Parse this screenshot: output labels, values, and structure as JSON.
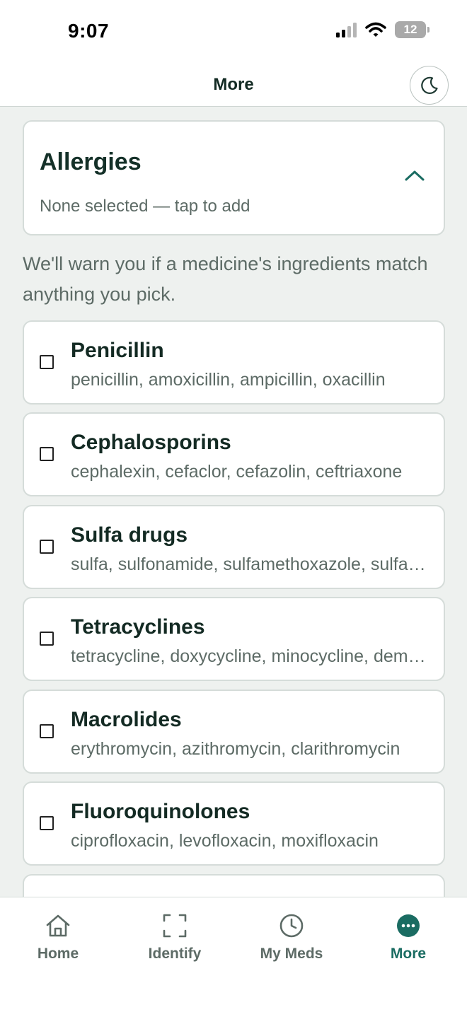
{
  "status_bar": {
    "time": "9:07",
    "battery": "12"
  },
  "header": {
    "title": "More",
    "theme_icon": "moon-icon"
  },
  "allergies": {
    "title": "Allergies",
    "subtitle": "None selected — tap to add",
    "helper": "We'll warn you if a medicine's ingredients match anything you pick."
  },
  "items": [
    {
      "title": "Penicillin",
      "sub": "penicillin, amoxicillin, ampicillin, oxacillin"
    },
    {
      "title": "Cephalosporins",
      "sub": "cephalexin, cefaclor, cefazolin, ceftriaxone"
    },
    {
      "title": "Sulfa drugs",
      "sub": "sulfa, sulfonamide, sulfamethoxazole, sulfasalazine"
    },
    {
      "title": "Tetracyclines",
      "sub": "tetracycline, doxycycline, minocycline, demeclocycline"
    },
    {
      "title": "Macrolides",
      "sub": "erythromycin, azithromycin, clarithromycin"
    },
    {
      "title": "Fluoroquinolones",
      "sub": "ciprofloxacin, levofloxacin, moxifloxacin"
    }
  ],
  "tabs": [
    {
      "label": "Home",
      "icon": "home-icon"
    },
    {
      "label": "Identify",
      "icon": "scan-icon"
    },
    {
      "label": "My Meds",
      "icon": "clock-icon"
    },
    {
      "label": "More",
      "icon": "more-icon"
    }
  ],
  "colors": {
    "accent": "#1a6c62",
    "text": "#143028",
    "muted": "#5d6b66",
    "background": "#eef1ef"
  }
}
